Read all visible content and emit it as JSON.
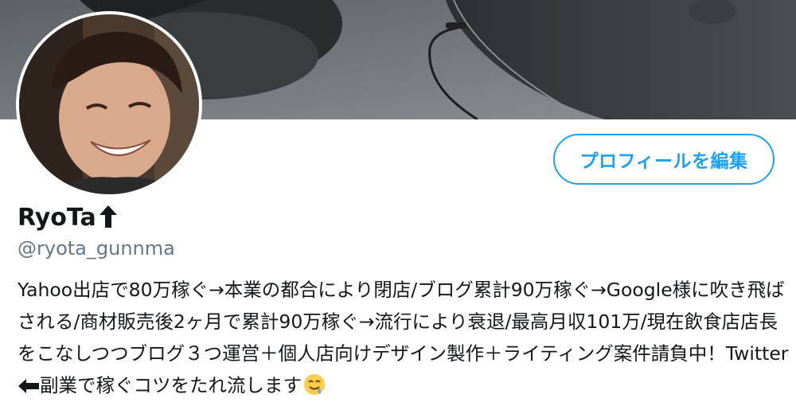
{
  "profile": {
    "display_name": "RyoTa",
    "handle": "@ryota_gunnma",
    "edit_button_label": "プロフィールを編集",
    "bio": {
      "text": "Yahoo出店で80万稼ぐ→本業の都合により閉店/ブログ累計90万稼ぐ→Google様に吹き飛ばされる/商材販売後2ヶ月で累計90万稼ぐ→流行により衰退/最高月収101万/現在飲食店店長をこなしつつブログ３つ運営＋個人店向けデザイン製作＋ライティング案件請負中！Twitter",
      "arrow_icon": "left-arrow-icon",
      "tail_text": "副業で稼ぐコツをたれ流します",
      "emoji_icon": "drooling-face-icon"
    },
    "name_badge_icon": "up-arrow-icon"
  },
  "colors": {
    "accent": "#1da1f2",
    "text_primary": "#14171a",
    "text_secondary": "#657786"
  }
}
